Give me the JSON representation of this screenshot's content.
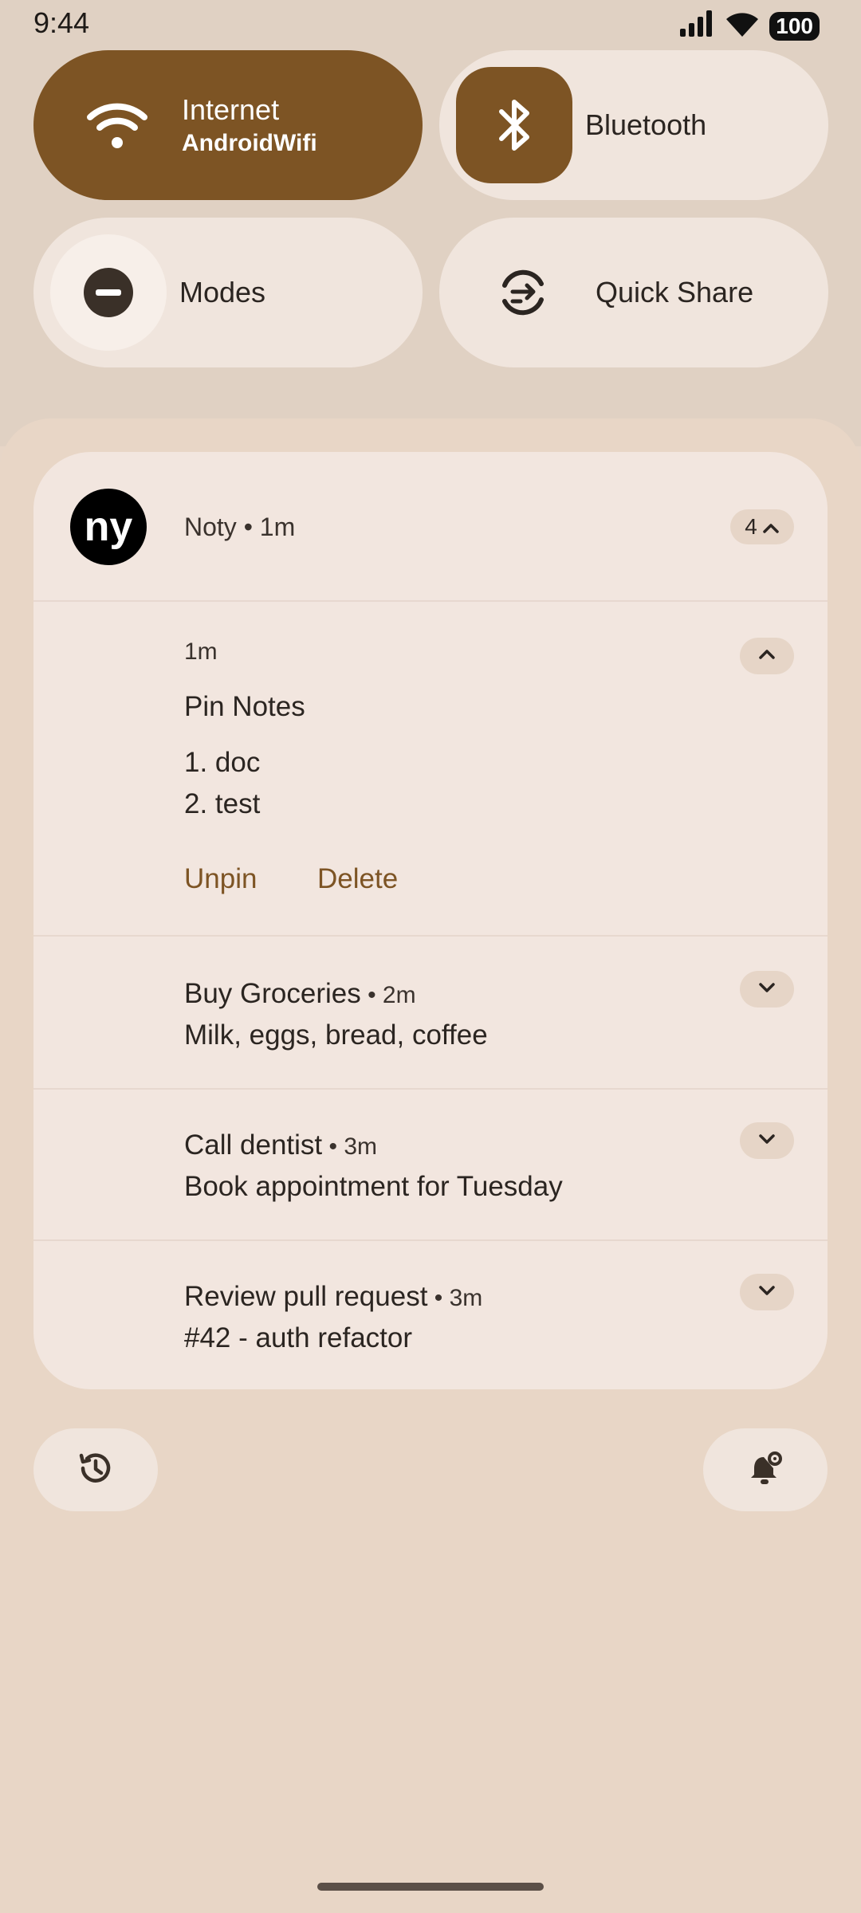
{
  "status_bar": {
    "time": "9:44",
    "battery": "100",
    "signal_icon": "cell-signal-icon",
    "wifi_icon": "wifi-icon"
  },
  "quick_settings": {
    "internet": {
      "label": "Internet",
      "subtitle": "AndroidWifi",
      "icon": "wifi-icon",
      "state": "on"
    },
    "bluetooth": {
      "label": "Bluetooth",
      "icon": "bluetooth-icon",
      "state": "on"
    },
    "modes": {
      "label": "Modes",
      "icon": "do-not-disturb-icon",
      "state": "off"
    },
    "quick_share": {
      "label": "Quick Share",
      "icon": "quick-share-icon",
      "state": "off"
    }
  },
  "notification_group": {
    "app_initials": "ny",
    "header_text": "Noty • 1m",
    "count": "4",
    "notifications": [
      {
        "time": "1m",
        "title": "Pin Notes",
        "lines": [
          "1. doc",
          "2. test"
        ],
        "actions": [
          "Unpin",
          "Delete"
        ],
        "expanded": true
      },
      {
        "title": "Buy Groceries",
        "time": " • 2m",
        "body": "Milk, eggs, bread, coffee",
        "expanded": false
      },
      {
        "title": "Call dentist",
        "time": " • 3m",
        "body": "Book appointment for Tuesday",
        "expanded": false
      },
      {
        "title": "Review pull request",
        "time": " • 3m",
        "body": "#42 - auth refactor",
        "expanded": false
      }
    ]
  },
  "bottom_actions": {
    "history_icon": "history-icon",
    "settings_icon": "notification-settings-icon"
  },
  "colors": {
    "accent": "#7d5424",
    "tile_bg": "#f0e5dd",
    "card_bg": "#f2e6df",
    "shade_bg": "#e8d6c6"
  }
}
